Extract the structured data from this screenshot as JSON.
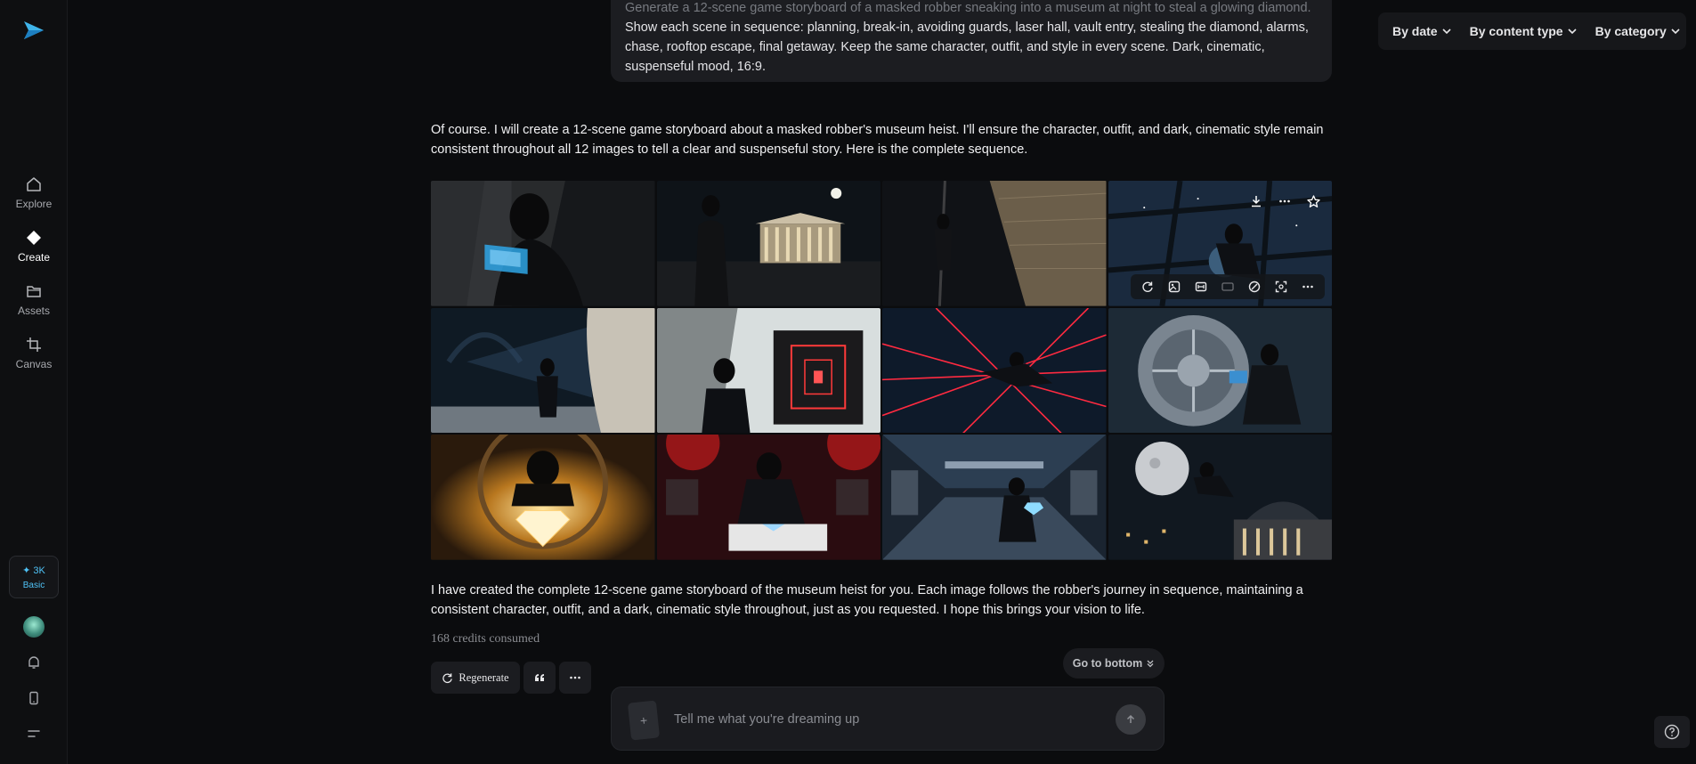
{
  "sidebar": {
    "logo_icon": "paper-plane-logo",
    "nav": [
      {
        "label": "Explore",
        "icon": "home-icon"
      },
      {
        "label": "Create",
        "icon": "diamond-icon"
      },
      {
        "label": "Assets",
        "icon": "folder-icon"
      },
      {
        "label": "Canvas",
        "icon": "crop-icon"
      }
    ],
    "credits": {
      "amount": "✦ 3K",
      "plan": "Basic"
    },
    "accent": "#4fc3f7"
  },
  "filters": {
    "by_date": "By date",
    "by_content_type": "By content type",
    "by_category": "By category"
  },
  "prompt": {
    "line1": "Generate a 12-scene game storyboard of a masked robber sneaking into a museum at night to steal a glowing diamond.",
    "text": "Show each scene in sequence: planning, break-in, avoiding guards, laser hall, vault entry, stealing the diamond, alarms, chase, rooftop escape, final getaway. Keep the same character, outfit, and style in every scene. Dark, cinematic, suspenseful mood, 16:9."
  },
  "reply_intro": "Of course. I will create a 12-scene game storyboard about a masked robber's museum heist. I'll ensure the character, outfit, and dark, cinematic style remain consistent throughout all 12 images to tell a clear and suspenseful story. Here is the complete sequence.",
  "reply_outro": "I have created the complete 12-scene game storyboard of the museum heist for you. Each image follows the robber's journey in sequence, maintaining a consistent character, outfit, and a dark, cinematic style throughout, just as you requested. I hope this brings your vision to life.",
  "credits_consumed": "168 credits consumed",
  "actions": {
    "regenerate": "Regenerate"
  },
  "go_to_bottom": "Go to bottom",
  "composer": {
    "placeholder": "Tell me what you're dreaming up"
  },
  "images": [
    {
      "scene": "planning"
    },
    {
      "scene": "museum-exterior-night"
    },
    {
      "scene": "climbing-wall"
    },
    {
      "scene": "skylight-entry"
    },
    {
      "scene": "avoiding-guard"
    },
    {
      "scene": "laser-corridor"
    },
    {
      "scene": "laser-hall-jump"
    },
    {
      "scene": "vault-cracking"
    },
    {
      "scene": "glowing-diamond"
    },
    {
      "scene": "stealing-diamond-alarm"
    },
    {
      "scene": "chase"
    },
    {
      "scene": "rooftop-escape-moon"
    }
  ]
}
